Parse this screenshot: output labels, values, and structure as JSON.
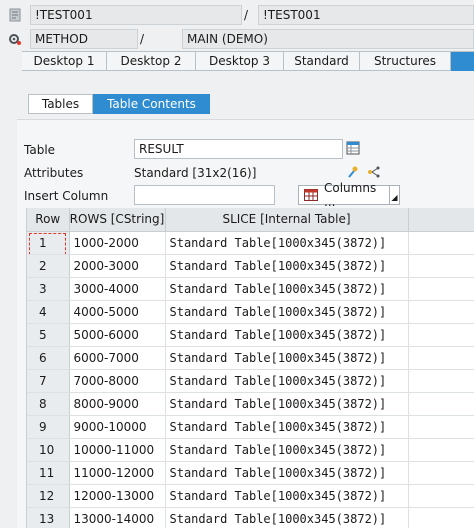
{
  "context": {
    "row1": {
      "field_a": "!TEST001",
      "separator": "/",
      "field_b": "!TEST001"
    },
    "row2": {
      "icon": "gear-icon",
      "field_a": "METHOD",
      "separator": "/",
      "field_b": "MAIN (DEMO)"
    }
  },
  "tabs": [
    "Desktop 1",
    "Desktop 2",
    "Desktop 3",
    "Standard",
    "Structures"
  ],
  "subtabs": {
    "tables": "Tables",
    "table_contents": "Table Contents"
  },
  "form": {
    "table_label": "Table",
    "table_value": "RESULT",
    "attributes_label": "Attributes",
    "attributes_value": "Standard [31x2(16)]",
    "insert_column_label": "Insert Column",
    "insert_column_value": "",
    "columns_button": "Columns ..."
  },
  "grid": {
    "headers": {
      "row": "Row",
      "rows": "ROWS [CString]",
      "slice": "SLICE [Internal Table]"
    },
    "rows": [
      {
        "row": "1",
        "rows": "1000-2000",
        "slice": "Standard Table[1000x345(3872)]"
      },
      {
        "row": "2",
        "rows": "2000-3000",
        "slice": "Standard Table[1000x345(3872)]"
      },
      {
        "row": "3",
        "rows": "3000-4000",
        "slice": "Standard Table[1000x345(3872)]"
      },
      {
        "row": "4",
        "rows": "4000-5000",
        "slice": "Standard Table[1000x345(3872)]"
      },
      {
        "row": "5",
        "rows": "5000-6000",
        "slice": "Standard Table[1000x345(3872)]"
      },
      {
        "row": "6",
        "rows": "6000-7000",
        "slice": "Standard Table[1000x345(3872)]"
      },
      {
        "row": "7",
        "rows": "7000-8000",
        "slice": "Standard Table[1000x345(3872)]"
      },
      {
        "row": "8",
        "rows": "8000-9000",
        "slice": "Standard Table[1000x345(3872)]"
      },
      {
        "row": "9",
        "rows": "9000-10000",
        "slice": "Standard Table[1000x345(3872)]"
      },
      {
        "row": "10",
        "rows": "10000-11000",
        "slice": "Standard Table[1000x345(3872)]"
      },
      {
        "row": "11",
        "rows": "11000-12000",
        "slice": "Standard Table[1000x345(3872)]"
      },
      {
        "row": "12",
        "rows": "12000-13000",
        "slice": "Standard Table[1000x345(3872)]"
      },
      {
        "row": "13",
        "rows": "13000-14000",
        "slice": "Standard Table[1000x345(3872)]"
      }
    ]
  },
  "colors": {
    "accent": "#2f8cd1",
    "focus": "#e2382b"
  }
}
